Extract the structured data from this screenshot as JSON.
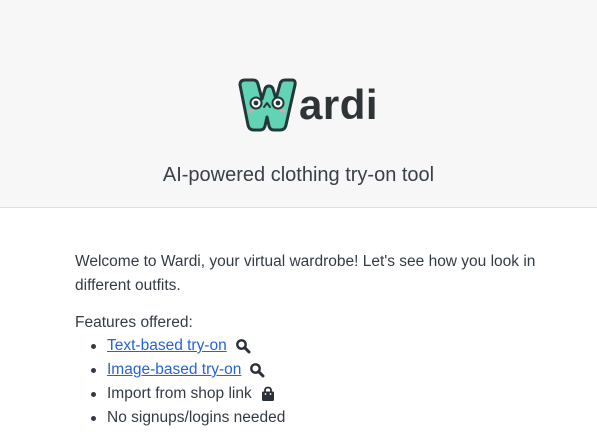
{
  "brand": {
    "logo_letter": "W",
    "logo_rest": "ardi",
    "tagline": "AI-powered clothing try-on tool"
  },
  "main": {
    "welcome": "Welcome to Wardi, your virtual wardrobe! Let's see how you look in different outfits.",
    "features_heading": "Features offered:",
    "features": [
      {
        "label": "Text-based try-on",
        "link": true,
        "icon": "search-icon"
      },
      {
        "label": "Image-based try-on",
        "link": true,
        "icon": "search-icon"
      },
      {
        "label": "Import from shop link",
        "link": false,
        "icon": "shopping-bag-icon"
      },
      {
        "label": "No signups/logins needed",
        "link": false,
        "icon": ""
      }
    ]
  },
  "colors": {
    "header_bg": "#f7f7f8",
    "logo_teal": "#5fd0b3",
    "link": "#2563d6",
    "text": "#333b45"
  }
}
